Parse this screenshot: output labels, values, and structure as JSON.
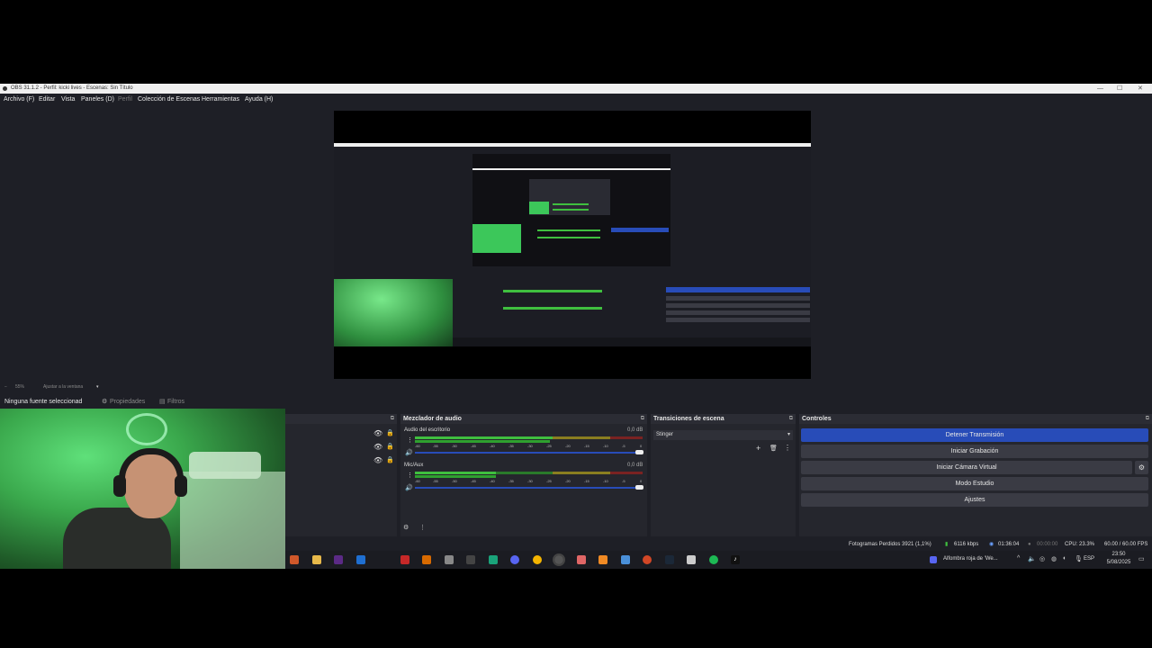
{
  "window": {
    "title": "OBS 31.1.2 - Perfil: kicki lives - Escenas: Sin Título",
    "controls": {
      "minimize": "—",
      "maximize": "☐",
      "close": "✕"
    }
  },
  "menu": {
    "items": [
      "Archivo (F)",
      "Editar",
      "Vista",
      "Paneles (D)",
      "Perfil",
      "Colección de Escenas",
      "Herramientas",
      "Ayuda (H)"
    ]
  },
  "zoom": {
    "minus": "−",
    "value": "55%",
    "fit_label": "Ajustar a la ventana"
  },
  "source_bar": {
    "no_source": "Ninguna fuente seleccionad",
    "properties": "Propiedades",
    "filters": "Filtros"
  },
  "audio_mixer": {
    "title": "Mezclador de audio",
    "channels": [
      {
        "name": "Audio del escritorio",
        "db": "0,0 dB"
      },
      {
        "name": "Mic/Aux",
        "db": "0,0 dB"
      }
    ],
    "ticks": [
      "-60",
      "-55",
      "-50",
      "-45",
      "-40",
      "-35",
      "-30",
      "-25",
      "-20",
      "-15",
      "-10",
      "-5",
      "0"
    ]
  },
  "transitions": {
    "title": "Transiciones de escena",
    "selected": "Stinger"
  },
  "controls": {
    "title": "Controles",
    "buttons": [
      "Detener Transmisión",
      "Iniciar Grabación",
      "Iniciar Cámara Virtual",
      "Modo Estudio",
      "Ajustes"
    ]
  },
  "status": {
    "dropped_frames": "Fotogramas Perdidos 3921 (1,1%)",
    "bitrate": "6116 kbps",
    "stream_time": "01:36:04",
    "rec_time": "00:00:00",
    "cpu": "CPU: 23.3%",
    "fps": "60.00 / 60.00 FPS"
  },
  "taskbar": {
    "now_playing": "Alfombra roja de 'We...",
    "language": "ESP",
    "time": "23:50",
    "date": "5/08/2025"
  },
  "colors": {
    "accent": "#284cb8",
    "meter_green": "#3fbf3f",
    "meter_yellow": "#b5a82a",
    "meter_red": "#b03030",
    "panel_bg": "#25262d"
  }
}
